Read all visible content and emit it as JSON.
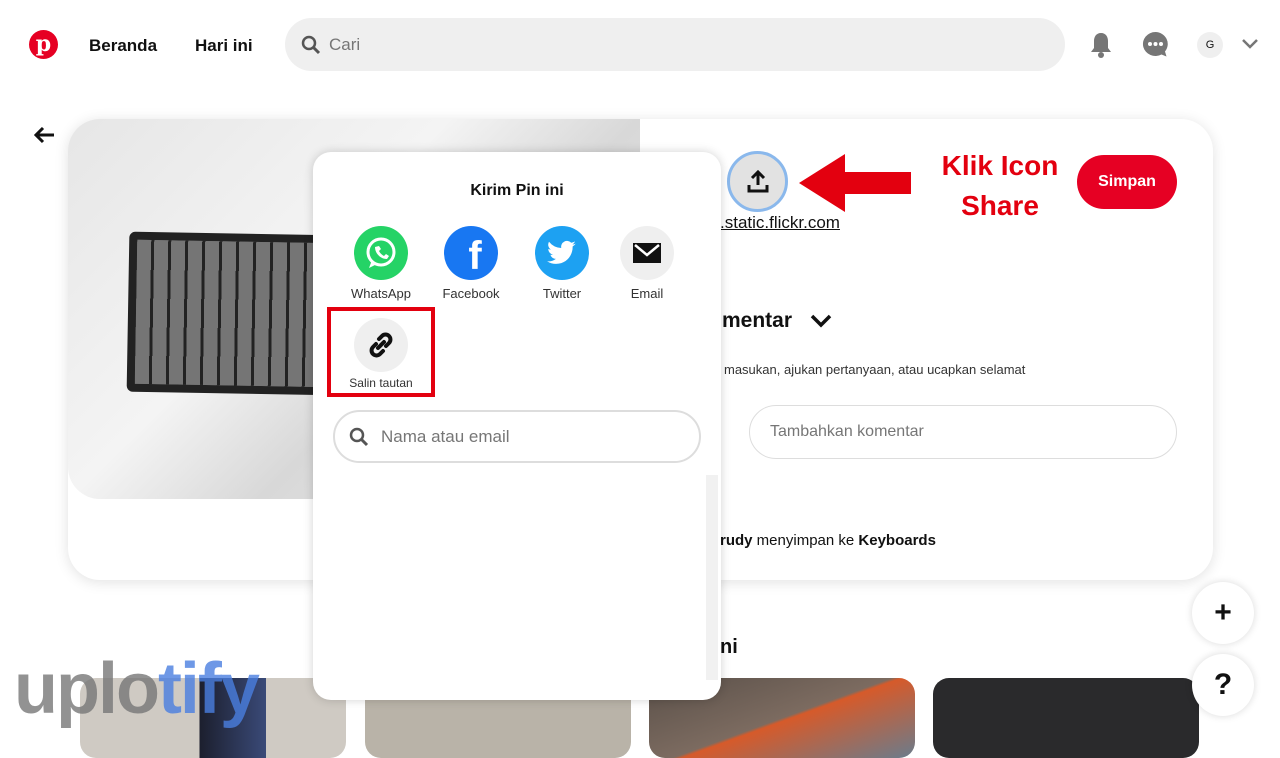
{
  "header": {
    "nav": [
      "Beranda",
      "Hari ini"
    ],
    "search_placeholder": "Cari",
    "avatar": "G"
  },
  "pin": {
    "source": ".static.flickr.com",
    "save": "Simpan",
    "comments_heading": "mentar",
    "comments_hint": "masukan, ajukan pertanyaan, atau ucapkan selamat",
    "comment_placeholder": "Tambahkan komentar",
    "saved_by_user": "rudy",
    "saved_by_text": " menyimpan ke ",
    "saved_board": "Keyboards",
    "more_heading": "ni"
  },
  "share": {
    "title": "Kirim Pin ini",
    "options": [
      "WhatsApp",
      "Facebook",
      "Twitter",
      "Email"
    ],
    "copy_link": "Salin tautan",
    "search_placeholder": "Nama atau email"
  },
  "annotation": {
    "line1": "Klik Icon",
    "line2": "Share",
    "color": "#e3000f"
  },
  "fab": {
    "add": "+",
    "help": "?"
  },
  "watermark": {
    "part1": "uplo",
    "part2": "tify"
  },
  "colors": {
    "brand": "#e60023",
    "whatsapp": "#25d366",
    "facebook": "#1877f2",
    "twitter": "#1da1f2"
  }
}
